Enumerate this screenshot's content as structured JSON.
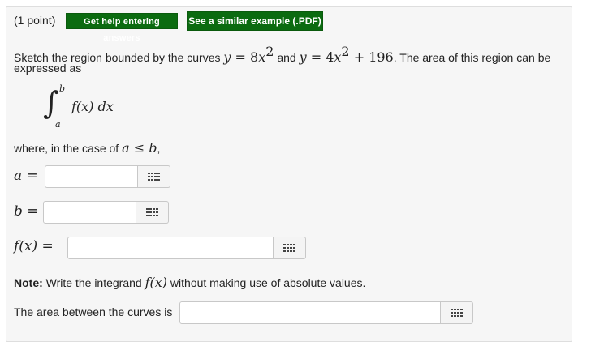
{
  "header": {
    "points": "(1 point)",
    "help_button": "Get help entering answers",
    "example_button": "See a similar example (.PDF)"
  },
  "problem": {
    "line1_prefix": "Sketch the region bounded by the curves ",
    "curve1_lhs": "y",
    "curve1_eq": " = 8",
    "curve1_var": "x",
    "curve1_exp": "2",
    "and": " and ",
    "curve2_lhs": "y",
    "curve2_eq": " = 4",
    "curve2_var": "x",
    "curve2_exp": "2",
    "curve2_rest": " + 196",
    "line1_suffix": ". The area of this region can be",
    "line2": "expressed as",
    "integral_upper": "b",
    "integral_lower": "a",
    "integrand": "f(x) dx",
    "where_prefix": "where, in the case of ",
    "where_math": "a ≤ b",
    "where_suffix": ","
  },
  "answers": {
    "a_label": "a =",
    "b_label": "b =",
    "f_label": "f(x) =",
    "a_value": "",
    "b_value": "",
    "f_value": "",
    "area_value": ""
  },
  "note": {
    "label": "Note:",
    "text_prefix": " Write the integrand ",
    "text_math": "f(x)",
    "text_suffix": " without making use of absolute values."
  },
  "area": {
    "label": "The area between the curves is"
  },
  "colors": {
    "button_green": "#0b6b10",
    "panel_bg": "#f6f6f6"
  },
  "icons": {
    "keyboard": "keypad-grid-icon"
  }
}
